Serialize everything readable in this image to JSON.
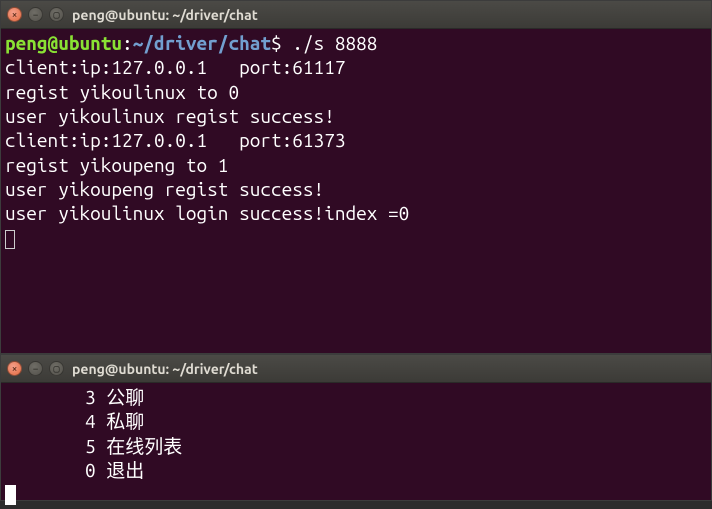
{
  "window1": {
    "title": "peng@ubuntu: ~/driver/chat",
    "prompt_user": "peng@ubuntu",
    "prompt_sep": ":",
    "prompt_path": "~/driver/chat",
    "prompt_dollar": "$ ",
    "command": "./s 8888",
    "lines": [
      "client:ip:127.0.0.1   port:61117",
      "regist yikoulinux to 0",
      "user yikoulinux regist success!",
      "client:ip:127.0.0.1   port:61373",
      "regist yikoupeng to 1",
      "user yikoupeng regist success!",
      "user yikoulinux login success!index =0"
    ]
  },
  "window2": {
    "title": "peng@ubuntu: ~/driver/chat",
    "menu": [
      {
        "num": "3",
        "label": "公聊"
      },
      {
        "num": "4",
        "label": "私聊"
      },
      {
        "num": "5",
        "label": "在线列表"
      },
      {
        "num": "0",
        "label": "退出"
      }
    ]
  },
  "controls": {
    "close": "×",
    "min": "−",
    "max": "▢"
  }
}
